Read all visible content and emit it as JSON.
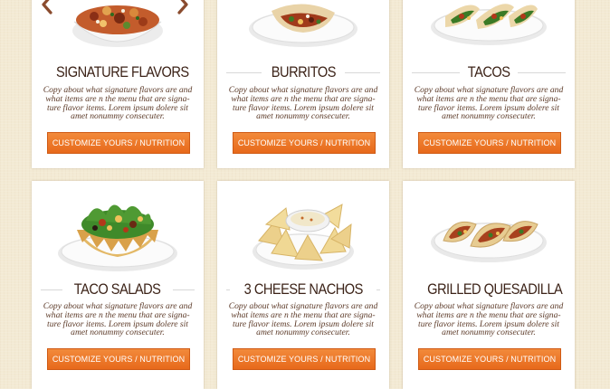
{
  "cards": [
    {
      "title": "SIGNATURE FLAVORS",
      "description": "Copy about what signature flavors are and what items are n the menu that are signa-ture flavor items. Lorem ipsum dolere sit amet nonummy consecuter.",
      "button_label": "CUSTOMIZE YOURS / NUTRITION",
      "image": "signature-flavors-bowl"
    },
    {
      "title": "BURRITOS",
      "description": "Copy about what signature flavors are and what items are n the menu that are signa-ture flavor items. Lorem ipsum dolere sit amet nonummy consecuter.",
      "button_label": "CUSTOMIZE YOURS / NUTRITION",
      "image": "burrito-plate"
    },
    {
      "title": "TACOS",
      "description": "Copy about what signature flavors are and what items are n the menu that are signa-ture flavor items. Lorem ipsum dolere sit amet nonummy consecuter.",
      "button_label": "CUSTOMIZE YOURS / NUTRITION",
      "image": "tacos-plate"
    },
    {
      "title": "TACO SALADS",
      "description": "Copy about what signature flavors are and what items are n the menu that are signa-ture flavor items. Lorem ipsum dolere sit amet nonummy consecuter.",
      "button_label": "CUSTOMIZE YOURS / NUTRITION",
      "image": "taco-salad-shell"
    },
    {
      "title": "3 CHEESE NACHOS",
      "description": "Copy about what signature flavors are and what items are n the menu that are signa-ture flavor items. Lorem ipsum dolere sit amet nonummy consecuter.",
      "button_label": "CUSTOMIZE YOURS / NUTRITION",
      "image": "nachos-plate"
    },
    {
      "title": "GRILLED QUESADILLA",
      "description": "Copy about what signature flavors are and what items are n the menu that are signa-ture flavor items. Lorem ipsum dolere sit amet nonummy consecuter.",
      "button_label": "CUSTOMIZE YOURS / NUTRITION",
      "image": "quesadilla-plate"
    }
  ],
  "carousel": {
    "prev_icon": "chevron-left-icon",
    "next_icon": "chevron-right-icon"
  },
  "colors": {
    "background": "#f3ead4",
    "button": "#ec7425",
    "title_text": "#3c2318",
    "body_text": "#5c3a28",
    "arrow": "#8a4b2e"
  }
}
